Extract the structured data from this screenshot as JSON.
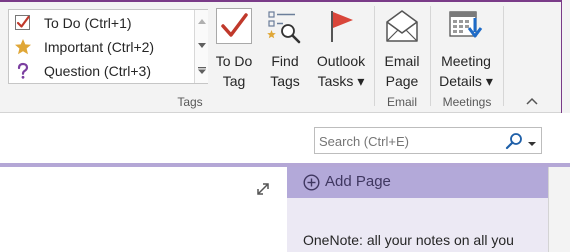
{
  "tags_gallery": {
    "items": [
      {
        "label": "To Do (Ctrl+1)",
        "icon": "checkbox-checked-icon"
      },
      {
        "label": "Important (Ctrl+2)",
        "icon": "star-icon"
      },
      {
        "label": "Question (Ctrl+3)",
        "icon": "question-mark-icon"
      }
    ]
  },
  "ribbon": {
    "todo_tag": {
      "line1": "To Do",
      "line2": "Tag",
      "icon": "todo-tag-icon"
    },
    "find_tags": {
      "line1": "Find",
      "line2": "Tags",
      "icon": "find-tags-icon"
    },
    "outlook_tasks": {
      "line1": "Outlook",
      "line2": "Tasks ▾",
      "icon": "flag-icon"
    },
    "email_page": {
      "line1": "Email",
      "line2": "Page",
      "icon": "envelope-icon"
    },
    "meeting_details": {
      "line1": "Meeting",
      "line2": "Details ▾",
      "icon": "calendar-icon"
    },
    "groups": {
      "tags": "Tags",
      "email": "Email",
      "meetings": "Meetings"
    }
  },
  "search": {
    "placeholder": "Search (Ctrl+E)"
  },
  "pages": {
    "add_page_label": "Add Page",
    "items": [
      {
        "title": "OneNote: all your notes on all you"
      }
    ]
  },
  "colors": {
    "accent_purple": "#7a3b88",
    "page_panel_header": "#b3a9d9",
    "page_panel_bg": "#ece9f4",
    "check_red": "#c0392b",
    "star_gold": "#e0a737",
    "question_purple": "#7b3fa0",
    "search_icon_blue": "#1e5fa8"
  }
}
